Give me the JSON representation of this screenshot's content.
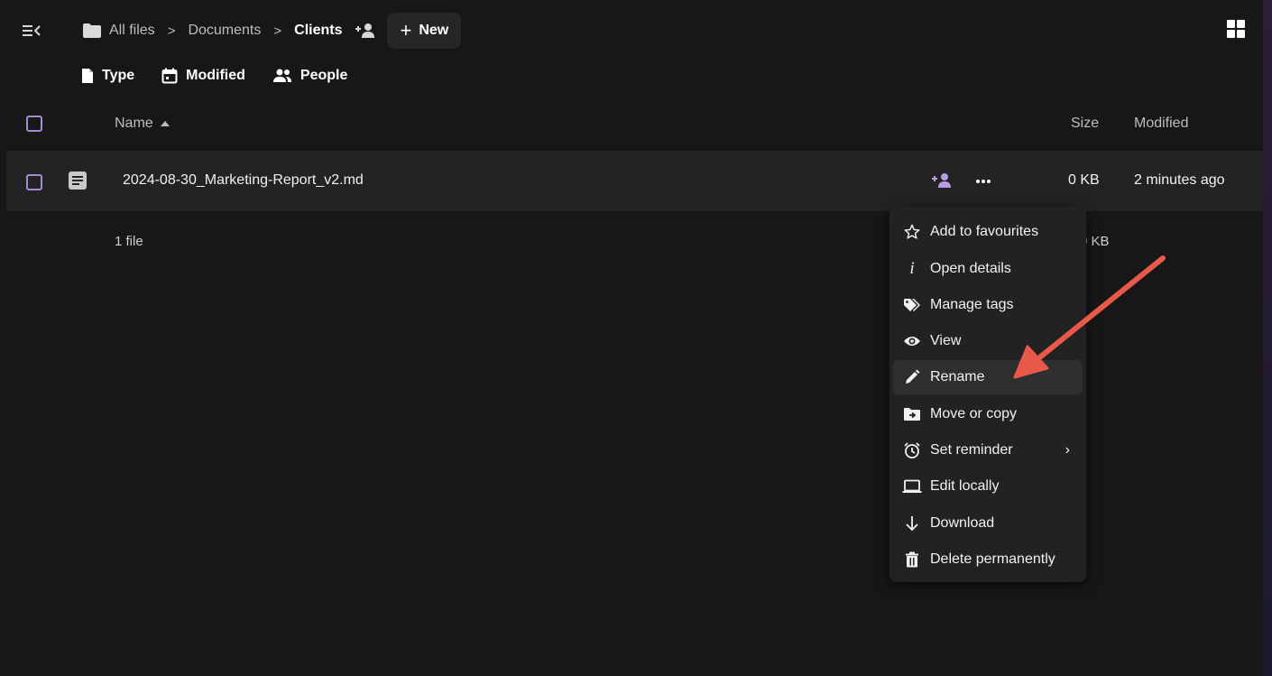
{
  "breadcrumb": {
    "items": [
      "All files",
      "Documents",
      "Clients"
    ],
    "new_label": "New"
  },
  "filters": [
    "Type",
    "Modified",
    "People"
  ],
  "table": {
    "columns": {
      "name": "Name",
      "size": "Size",
      "modified": "Modified"
    },
    "rows": [
      {
        "name": "2024-08-30_Marketing-Report_v2.md",
        "size": "0 KB",
        "modified": "2 minutes ago"
      }
    ],
    "summary": {
      "count": "1 file",
      "size": "0 KB"
    }
  },
  "context_menu": {
    "items": [
      {
        "label": "Add to favourites",
        "icon": "star-outline-icon"
      },
      {
        "label": "Open details",
        "icon": "info-icon"
      },
      {
        "label": "Manage tags",
        "icon": "tags-icon"
      },
      {
        "label": "View",
        "icon": "eye-icon"
      },
      {
        "label": "Rename",
        "icon": "pencil-icon"
      },
      {
        "label": "Move or copy",
        "icon": "folder-move-icon"
      },
      {
        "label": "Set reminder",
        "icon": "alarm-icon",
        "submenu_indicator": "›"
      },
      {
        "label": "Edit locally",
        "icon": "laptop-icon"
      },
      {
        "label": "Download",
        "icon": "arrow-down-icon"
      },
      {
        "label": "Delete permanently",
        "icon": "trash-icon"
      }
    ],
    "highlighted": "Rename"
  },
  "colors": {
    "background": "#171717",
    "row": "#232323",
    "menu": "#222222",
    "accent_purple": "#a58ad6",
    "annotation_arrow": "#e8594a"
  }
}
